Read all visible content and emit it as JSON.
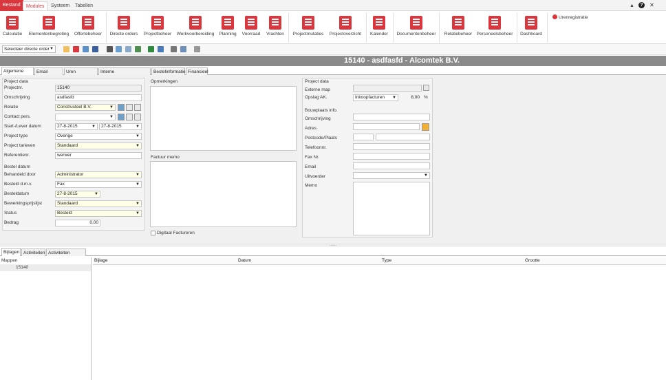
{
  "menu": {
    "tabs": [
      "Bestand",
      "Modules",
      "Systeem",
      "Tabellen"
    ],
    "window_controls": [
      "▴",
      "?",
      "✕"
    ]
  },
  "ribbon": {
    "buttons": [
      "Calculatie",
      "Elementenbegroting",
      "Offertebeheer",
      "Directe orders",
      "Projectbeheer",
      "Werkvoorbereiding",
      "Planning",
      "Voorraad",
      "Vrachten",
      "Projectmutaties",
      "Projectoverzicht",
      "Kalender",
      "Documentenbeheer",
      "Relatiebeheer",
      "Personeelsbeheer",
      "Dashboard"
    ],
    "urenregistratie": "Urenregistratie"
  },
  "toolbar": {
    "selector": "Selecteer directe order",
    "selector_arrow": "▼"
  },
  "title": "15140 - asdfasfd - Alcomtek B.V.",
  "tabs": [
    "Algemene info.",
    "Email bijlagen",
    "Uren registratie",
    "Interne projectverbruiken",
    "Bestelinformatie",
    "Financieel"
  ],
  "project_data": {
    "section": "Project data",
    "fields": [
      {
        "label": "Projectnr.",
        "value": "15140"
      },
      {
        "label": "Omschrijving",
        "value": "asdfasfd"
      },
      {
        "label": "Relatie",
        "value": "Construsteel  B.V."
      },
      {
        "label": "Contact pers.",
        "value": ""
      },
      {
        "label": "Start-/Lever datum",
        "value": "27-8-2015",
        "value2": "27-8-2015"
      },
      {
        "label": "Project type",
        "value": "Overige"
      },
      {
        "label": "Project tarieven",
        "value": "Standaard"
      },
      {
        "label": "Referentienr.",
        "value": "werwer"
      }
    ]
  },
  "bestel": {
    "section": "Bestel datum",
    "fields": [
      {
        "label": "Behandeld door",
        "value": "Administrator"
      },
      {
        "label": "Besteld d.m.v.",
        "value": "Fax"
      },
      {
        "label": "Besteldatum",
        "value": "27-8-2015"
      },
      {
        "label": "Bewerkingsprijslijst",
        "value": "Standaard"
      },
      {
        "label": "Status",
        "value": "Besteld"
      },
      {
        "label": "Bedrag",
        "value": "0,00"
      }
    ]
  },
  "opmerkingen": {
    "label": "Opmerkingen"
  },
  "factuur": {
    "label": "Factuur memo",
    "checkbox": "Digitaal Factureren"
  },
  "right": {
    "section": "Project data",
    "externe_map": "Externe map",
    "opslag_label": "Opslag AK.",
    "opslag_select": "Inkoopfacturen",
    "opslag_value": "8,00",
    "opslag_unit": "%",
    "bouw_section": "Bouwplaats info.",
    "bouw_fields": [
      "Omschrijving",
      "Adres",
      "Postcode/Plaats",
      "Telefoonnr.",
      "Fax Nr.",
      "Email",
      "Uitvoerder",
      "Memo"
    ]
  },
  "lower": {
    "tabs": [
      "Bijlagen",
      "Activiteiten",
      "Activiteiten Historie"
    ],
    "mappen": "Mappen",
    "tree_item": "15140",
    "columns": [
      "Bijlage",
      "Datum",
      "Type",
      "Grootte"
    ]
  },
  "colors": {
    "accent": "#d9363e",
    "title_bg": "#8a8a8a"
  }
}
